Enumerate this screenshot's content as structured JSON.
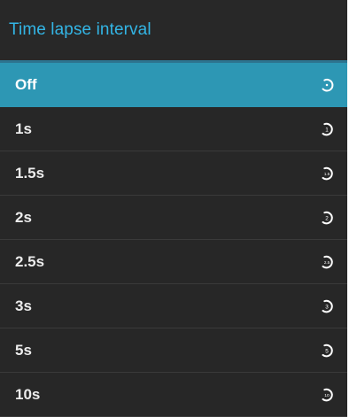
{
  "dialog": {
    "title": "Time lapse interval",
    "selected_index": 0,
    "accent_color": "#33b5e5",
    "selected_bg": "#2d97b4",
    "items": [
      {
        "label": "Off",
        "icon": "timer-off-icon",
        "icon_text": ""
      },
      {
        "label": "1s",
        "icon": "timer-1s-icon",
        "icon_text": "1"
      },
      {
        "label": "1.5s",
        "icon": "timer-1-5s-icon",
        "icon_text": "1.5"
      },
      {
        "label": "2s",
        "icon": "timer-2s-icon",
        "icon_text": "2"
      },
      {
        "label": "2.5s",
        "icon": "timer-2-5s-icon",
        "icon_text": "2.5"
      },
      {
        "label": "3s",
        "icon": "timer-3s-icon",
        "icon_text": "3"
      },
      {
        "label": "5s",
        "icon": "timer-5s-icon",
        "icon_text": "5"
      },
      {
        "label": "10s",
        "icon": "timer-10s-icon",
        "icon_text": "10"
      }
    ]
  }
}
